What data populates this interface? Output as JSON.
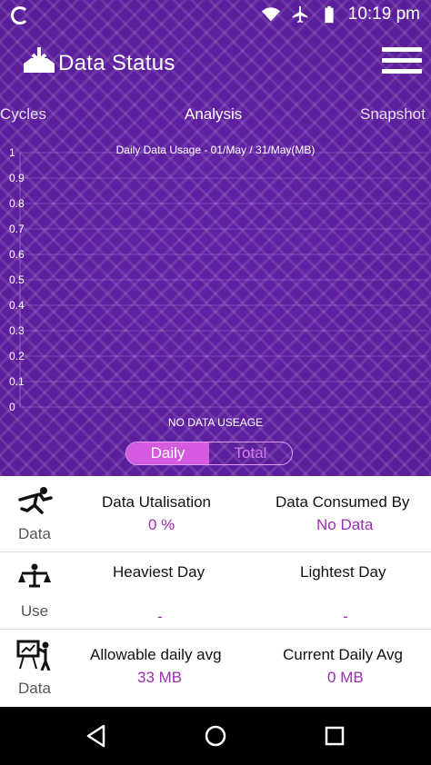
{
  "status_bar": {
    "time": "10:19",
    "time_suffix": "pm",
    "icons": [
      "app-status-icon",
      "wifi-icon",
      "airplane-icon",
      "battery-icon"
    ]
  },
  "header": {
    "title": "Data Status",
    "logo_icon": "download-tray-icon",
    "menu_icon": "hamburger-menu-icon"
  },
  "tabs": [
    {
      "label": "Cycles"
    },
    {
      "label": "Analysis"
    },
    {
      "label": "Snapshot"
    }
  ],
  "chart_data": {
    "type": "line",
    "title": "Daily Data Usage - 01/May / 31/May(MB)",
    "y_tick_labels": [
      "1",
      "0.9",
      "0.8",
      "0.7",
      "0.6",
      "0.5",
      "0.4",
      "0.3",
      "0.2",
      "0.1",
      "0"
    ],
    "ylim": [
      0,
      1
    ],
    "series": [],
    "empty_message": "NO DATA USEAGE"
  },
  "toggle": {
    "options": [
      "Daily",
      "Total"
    ],
    "selected": "Daily"
  },
  "stats": [
    {
      "side_label": "Data",
      "icon": "runner-icon",
      "left": {
        "label": "Data Utalisation",
        "value": "0 %"
      },
      "right": {
        "label": "Data Consumed By",
        "value": "No Data"
      }
    },
    {
      "side_label": "Use",
      "icon": "scales-person-icon",
      "left": {
        "label": "Heaviest Day",
        "value": "-"
      },
      "right": {
        "label": "Lightest Day",
        "value": "-"
      }
    },
    {
      "side_label": "Data",
      "icon": "presentation-board-icon",
      "left": {
        "label": "Allowable daily avg",
        "value": "33 MB"
      },
      "right": {
        "label": "Current Daily Avg",
        "value": "0 MB"
      }
    }
  ],
  "nav_bar": {
    "buttons": [
      "back-icon",
      "home-icon",
      "recents-icon"
    ]
  },
  "colors": {
    "primary_purple": "#6a23b3",
    "accent_magenta": "#d45be0",
    "value_purple": "#9b2fb0"
  }
}
